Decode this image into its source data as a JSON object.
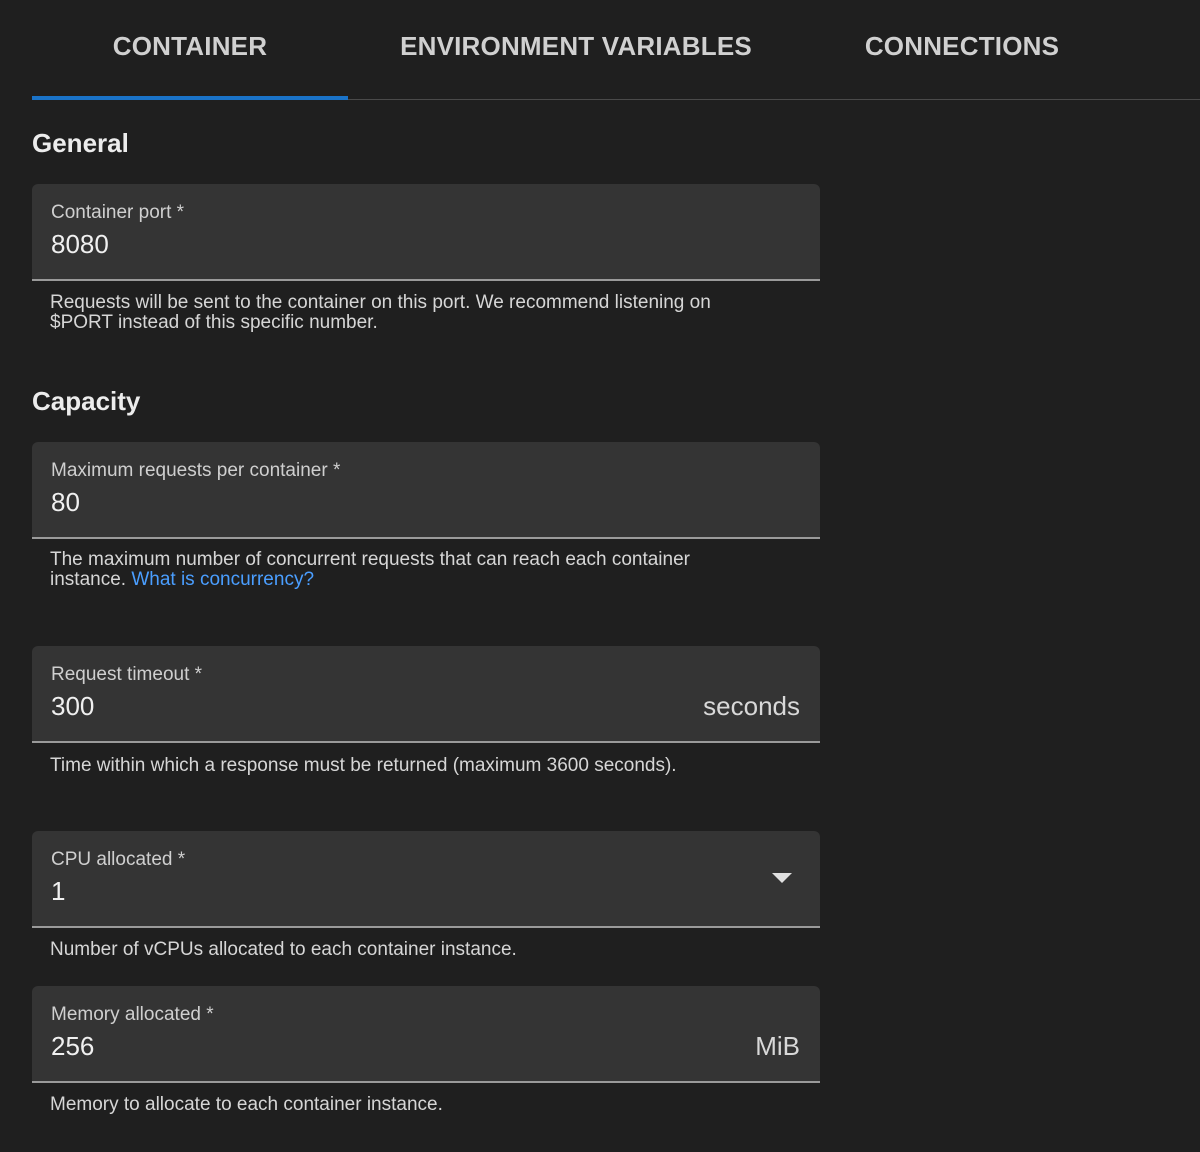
{
  "tabs": [
    {
      "label": "CONTAINER",
      "active": true
    },
    {
      "label": "ENVIRONMENT VARIABLES",
      "active": false
    },
    {
      "label": "CONNECTIONS",
      "active": false
    }
  ],
  "accent_color": "#1a73c8",
  "link_color": "#4a9eff",
  "general": {
    "title": "General",
    "container_port": {
      "label": "Container port *",
      "value": "8080",
      "helper": "Requests will be sent to the container on this port. We recommend listening on $PORT instead of this specific number."
    }
  },
  "capacity": {
    "title": "Capacity",
    "max_requests": {
      "label": "Maximum requests per container *",
      "value": "80",
      "helper": "The maximum number of concurrent requests that can reach each container instance.",
      "helper_link": "What is concurrency?"
    },
    "request_timeout": {
      "label": "Request timeout *",
      "value": "300",
      "suffix": "seconds",
      "helper": "Time within which a response must be returned (maximum 3600 seconds)."
    },
    "cpu": {
      "label": "CPU allocated *",
      "value": "1",
      "icon": "chevron-down-icon",
      "helper": "Number of vCPUs allocated to each container instance."
    },
    "memory": {
      "label": "Memory allocated *",
      "value": "256",
      "suffix": "MiB",
      "helper": "Memory to allocate to each container instance."
    }
  }
}
